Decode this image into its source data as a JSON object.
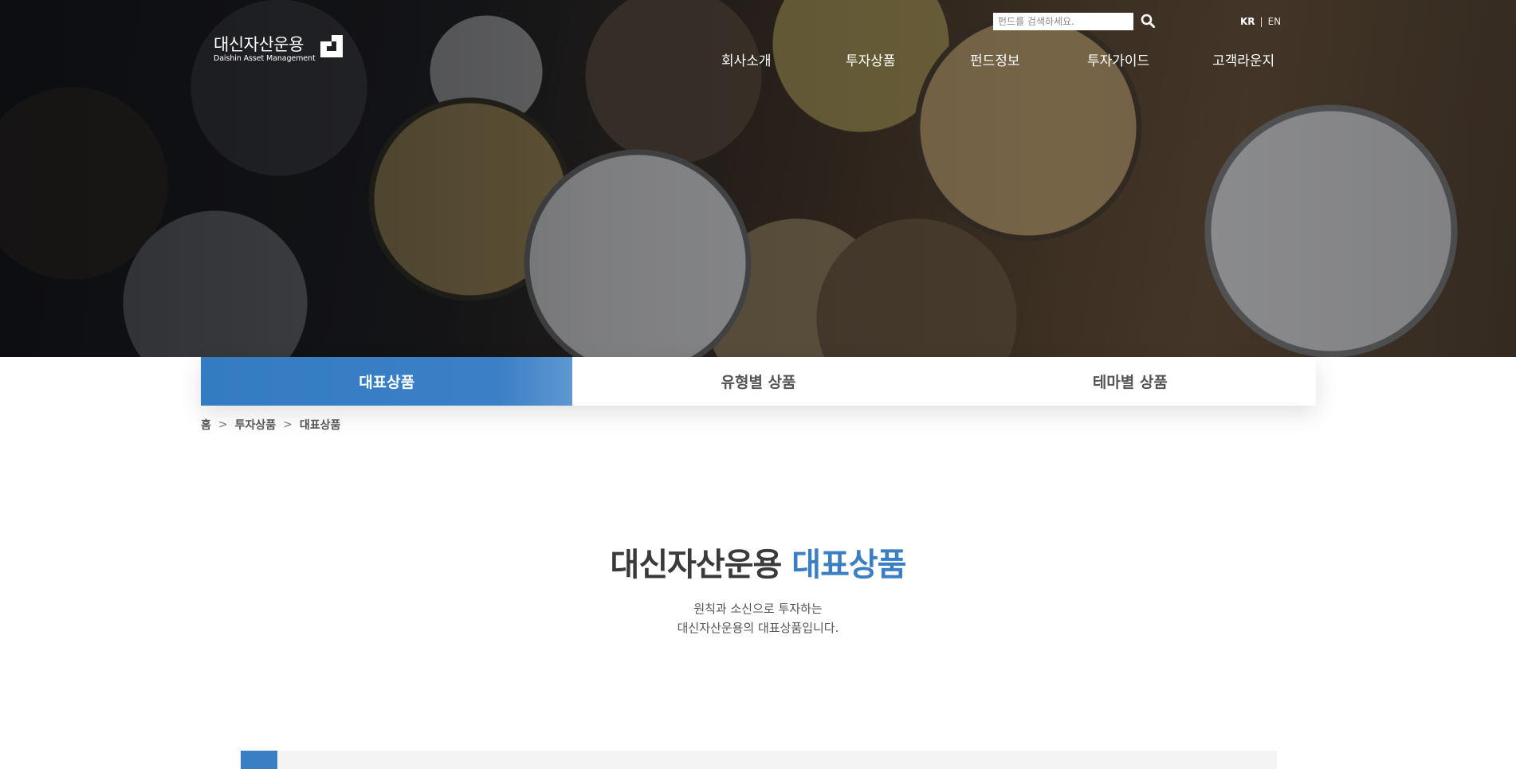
{
  "brand": {
    "name_ko": "대신자산운용",
    "name_en": "Daishin Asset Management",
    "accent_color": "#3a7ec4"
  },
  "search": {
    "placeholder": "펀드를 검색하세요.",
    "value": "",
    "icon": "search-icon"
  },
  "lang": {
    "kr": "KR",
    "separator": "|",
    "en": "EN"
  },
  "nav": {
    "items": [
      "회사소개",
      "투자상품",
      "펀드정보",
      "투자가이드",
      "고객라운지"
    ]
  },
  "tabs": [
    {
      "label": "대표상품",
      "active": true
    },
    {
      "label": "유형별 상품",
      "active": false
    },
    {
      "label": "테마별 상품",
      "active": false
    }
  ],
  "breadcrumb": {
    "items": [
      "홈",
      "투자상품",
      "대표상품"
    ],
    "separator": ">"
  },
  "page": {
    "title_main": "대신자산운용",
    "title_accent": "대표상품",
    "subtitle_line1": "원칙과 소신으로 투자하는",
    "subtitle_line2": "대신자산운용의 대표상품입니다."
  }
}
